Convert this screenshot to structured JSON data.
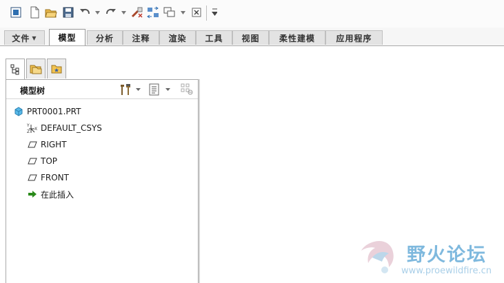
{
  "toolbar": {
    "buttons": [
      "window-icon",
      "new-icon",
      "open-icon",
      "save-icon",
      "undo-icon",
      "redo-icon",
      "regenerate-icon",
      "switch-windows-icon",
      "close-icon"
    ],
    "more": "▾"
  },
  "ribbon": {
    "tabs": [
      {
        "label": "文件",
        "has_menu": true
      },
      {
        "label": "模型",
        "active": true
      },
      {
        "label": "分析"
      },
      {
        "label": "注释"
      },
      {
        "label": "渲染"
      },
      {
        "label": "工具"
      },
      {
        "label": "视图"
      },
      {
        "label": "柔性建模"
      },
      {
        "label": "应用程序"
      }
    ]
  },
  "navigator": {
    "title": "模型树",
    "tree": [
      {
        "label": "PRT0001.PRT",
        "icon": "part-icon"
      },
      {
        "label": "DEFAULT_CSYS",
        "icon": "csys-icon"
      },
      {
        "label": "RIGHT",
        "icon": "datum-plane-icon"
      },
      {
        "label": "TOP",
        "icon": "datum-plane-icon"
      },
      {
        "label": "FRONT",
        "icon": "datum-plane-icon"
      },
      {
        "label": "在此插入",
        "icon": "insert-arrow-icon"
      }
    ]
  },
  "watermark": {
    "title": "野火论坛",
    "url": "www.proewildfire.cn"
  },
  "colors": {
    "accent_blue": "#1f6fb5",
    "watermark": "#7fb9de",
    "insert_green": "#2a8a1a"
  }
}
